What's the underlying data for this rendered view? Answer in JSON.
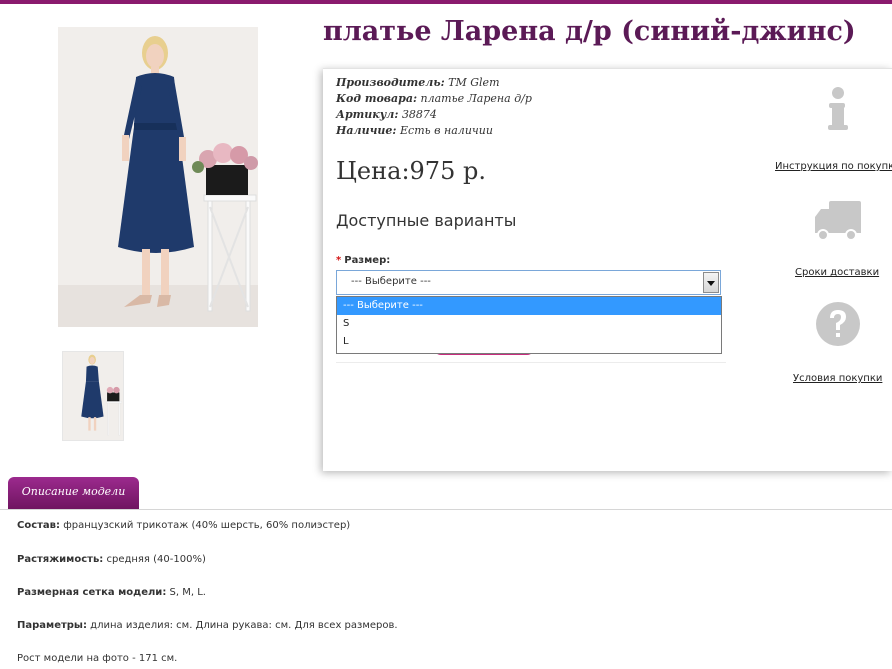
{
  "product": {
    "title": "платье Ларена д/р (синий-джинс)",
    "meta": [
      {
        "key": "Производитель:",
        "value": "TM Glem"
      },
      {
        "key": "Код товара:",
        "value": "платье Ларена д/р"
      },
      {
        "key": "Артикул:",
        "value": "38874"
      },
      {
        "key": "Наличие:",
        "value": "Есть в наличии"
      }
    ],
    "price": "Цена:975 р."
  },
  "variants": {
    "title": "Доступные варианты",
    "required_mark": "*",
    "size_label": "Размер:",
    "select_value": "--- Выберите ---",
    "options": [
      "--- Выберите ---",
      "S",
      "L"
    ]
  },
  "side_links": {
    "instruction": "Инструкция по покупке",
    "delivery": "Сроки доставки",
    "terms": "Условия покупки"
  },
  "tabs": {
    "description": "Описание модели"
  },
  "description": {
    "rows": [
      {
        "key": "Состав:",
        "value": "французский трикотаж (40% шерсть, 60% полиэстер)"
      },
      {
        "key": "Растяжимость:",
        "value": "средняя (40-100%)"
      },
      {
        "key": "Размерная сетка модели:",
        "value": "S, M, L."
      },
      {
        "key": "Параметры:",
        "value": "длина изделия: см. Длина рукава: см. Для всех размеров."
      },
      {
        "key": "",
        "value": "Рост модели на фото - 171 см."
      }
    ]
  },
  "colors": {
    "accent": "#5b1a56",
    "tab": "#8a1f7d",
    "buy_button": "#c72d7e",
    "dress": "#1f3a6b",
    "icon_gray": "#c8c8c8"
  },
  "icons": [
    "info-icon",
    "delivery-truck-icon",
    "question-icon"
  ]
}
